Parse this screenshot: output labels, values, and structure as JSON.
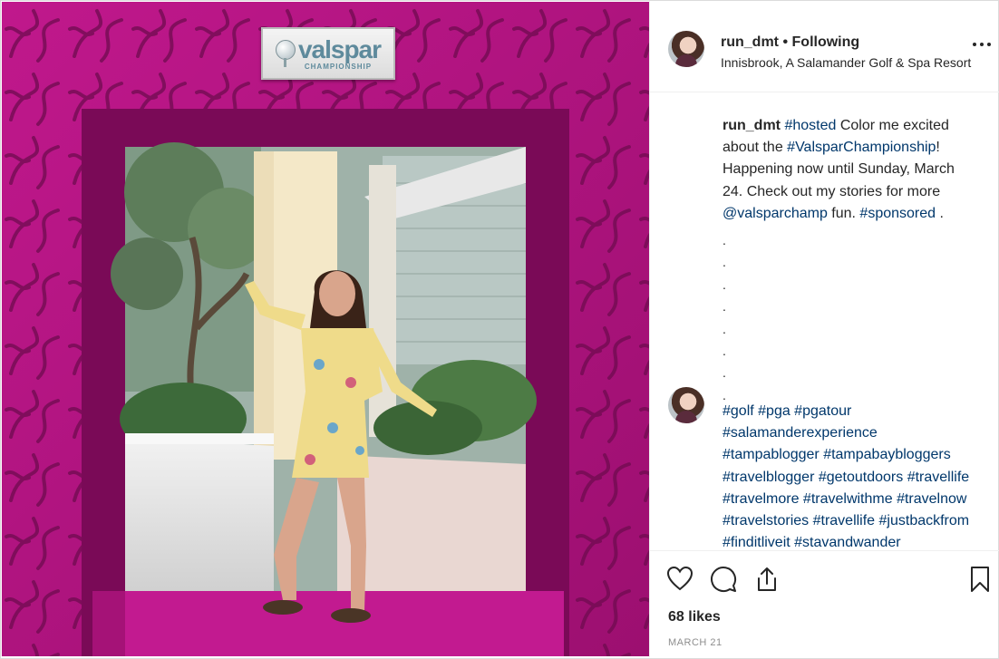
{
  "colors": {
    "frame": "#b0157f",
    "link": "#00376b",
    "muted": "#8e8e8e",
    "divider": "#efefef"
  },
  "photo": {
    "description_icon": "photo-of-woman-in-pink-frame",
    "sign": {
      "brand": "valspar",
      "subtitle": "CHAMPIONSHIP"
    }
  },
  "post_header": {
    "username": "run_dmt",
    "separator": "•",
    "follow_state": "Following",
    "location": "Innisbrook, A Salamander Golf & Spa Resort",
    "more_icon": "more-options-icon"
  },
  "caption": {
    "username": "run_dmt",
    "part1": "#hosted",
    "part2": " Color me excited\nabout the ",
    "part3": "#ValsparChampionship",
    "part4": "!\nHappening now until Sunday, March\n24. Check out my stories for more\n",
    "part5": "@valsparchamp",
    "part6": " fun. ",
    "part7": "#sponsored",
    "part8": " .",
    "dots": ".\n.\n.\n.\n.\n.\n.\n."
  },
  "hashtag_comment": {
    "lines": [
      "#golf #pga #pgatour",
      "#salamanderexperience",
      "#tampablogger #tampabaybloggers",
      "#travelblogger #getoutdoors #travellife",
      "#travelmore #travelwithme #travelnow",
      "#travelstories #travellife #justbackfrom",
      "#finditliveit #stavandwander"
    ]
  },
  "actions": {
    "icons": [
      "heart-icon",
      "comment-icon",
      "share-icon",
      "bookmark-icon"
    ],
    "likes": "68 likes",
    "date": "MARCH 21"
  }
}
